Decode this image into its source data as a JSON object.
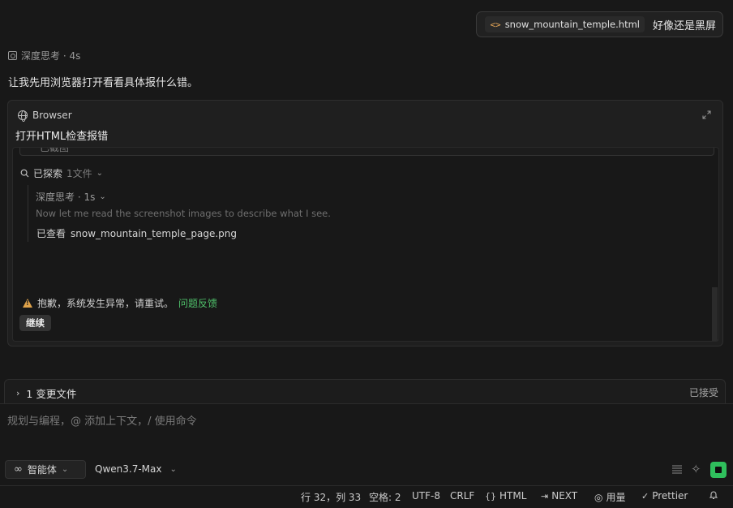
{
  "user_message": {
    "file_chip": "snow_mountain_temple.html",
    "text": "好像还是黑屏"
  },
  "thinking": {
    "label": "深度思考 · 4s"
  },
  "assistant_reply": "让我先用浏览器打开看看具体报什么错。",
  "browser_card": {
    "label": "Browser",
    "title": "打开HTML检查报错",
    "partial_row_text": "已截图",
    "explored": {
      "label": "已探索",
      "count": "1文件"
    },
    "nested": {
      "thinking": "深度思考 · 1s",
      "thought_text": "Now let me read the screenshot images to describe what I see.",
      "viewed_label": "已查看",
      "viewed_file": "snow_mountain_temple_page.png"
    },
    "error": {
      "text": "抱歉，系统发生异常，请重试。",
      "link": "问题反馈"
    },
    "continue_label": "继续"
  },
  "changes_bar": {
    "label": "1 变更文件",
    "accepted": "已接受"
  },
  "input": {
    "placeholder": "规划与编程，@ 添加上下文，/ 使用命令",
    "agent_label": "智能体",
    "model_label": "Qwen3.7-Max"
  },
  "status_bar": {
    "position": "行 32，列 33",
    "spaces": "空格: 2",
    "encoding": "UTF-8",
    "eol": "CRLF",
    "language": "HTML",
    "next": "NEXT",
    "usage": "用量",
    "prettier": "Prettier"
  },
  "colors": {
    "accent_green": "#2fbf5c",
    "link_green": "#4fc06a",
    "warning": "#e0a34a"
  },
  "icons": [
    "code-icon",
    "thinking-icon",
    "globe-icon",
    "expand-icon",
    "search-icon",
    "warning-icon",
    "chevron-right-icon",
    "infinity-icon",
    "chevron-down-icon",
    "list-icon",
    "sparkle-icon",
    "stop-icon",
    "braces-icon",
    "next-icon",
    "usage-icon",
    "check-icon",
    "bell-icon"
  ]
}
